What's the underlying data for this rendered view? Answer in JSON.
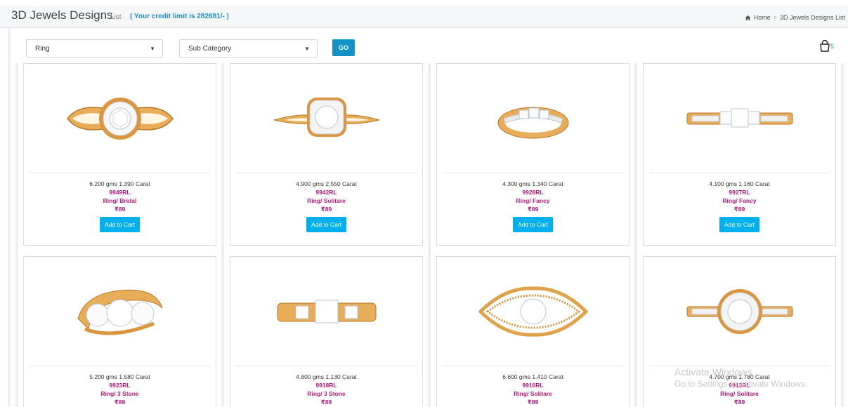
{
  "header": {
    "title": "3D Jewels Designs",
    "subtitle": "List",
    "credit": "( Your credit limit is 282681/- )",
    "breadcrumb": {
      "home": "Home",
      "sep": ">",
      "current": "3D Jewels Designs List"
    }
  },
  "filters": {
    "category": "Ring",
    "subcategory": "Sub Category",
    "go_label": "GO",
    "cart_count": "5"
  },
  "add_to_cart_label": "Add to Cart",
  "products": [
    {
      "weight": "6.200 gms",
      "carat": "1.390 Carat",
      "code": "9949RL",
      "category": "Ring/ Bridal",
      "price": "₹89"
    },
    {
      "weight": "4.900 gms",
      "carat": "2.550 Carat",
      "code": "9942RL",
      "category": "Ring/ Solitare",
      "price": "₹89"
    },
    {
      "weight": "4.300 gms",
      "carat": "1.340 Carat",
      "code": "9928RL",
      "category": "Ring/ Fancy",
      "price": "₹89"
    },
    {
      "weight": "4.100 gms",
      "carat": "1.160 Carat",
      "code": "9927RL",
      "category": "Ring/ Fancy",
      "price": "₹89"
    },
    {
      "weight": "5.200 gms",
      "carat": "1.580 Carat",
      "code": "9923RL",
      "category": "Ring/ 3 Stone",
      "price": "₹89"
    },
    {
      "weight": "4.800 gms",
      "carat": "1.130 Carat",
      "code": "9918RL",
      "category": "Ring/ 3 Stone",
      "price": "₹89"
    },
    {
      "weight": "6.600 gms",
      "carat": "1.410 Carat",
      "code": "9916RL",
      "category": "Ring/ Solitare",
      "price": "₹89"
    },
    {
      "weight": "4.700 gms",
      "carat": "1.780 Carat",
      "code": "9913RL",
      "category": "Ring/ Solitare",
      "price": "₹89"
    }
  ],
  "watermark": {
    "line1": "Activate Windows",
    "line2": "Go to Settings to activate Windows."
  },
  "colors": {
    "accent_blue": "#1392c7",
    "cart_button": "#00b0ed",
    "product_text": "#b5197b",
    "credit_text": "#1e8cd8",
    "gold": "#e0a24a"
  }
}
